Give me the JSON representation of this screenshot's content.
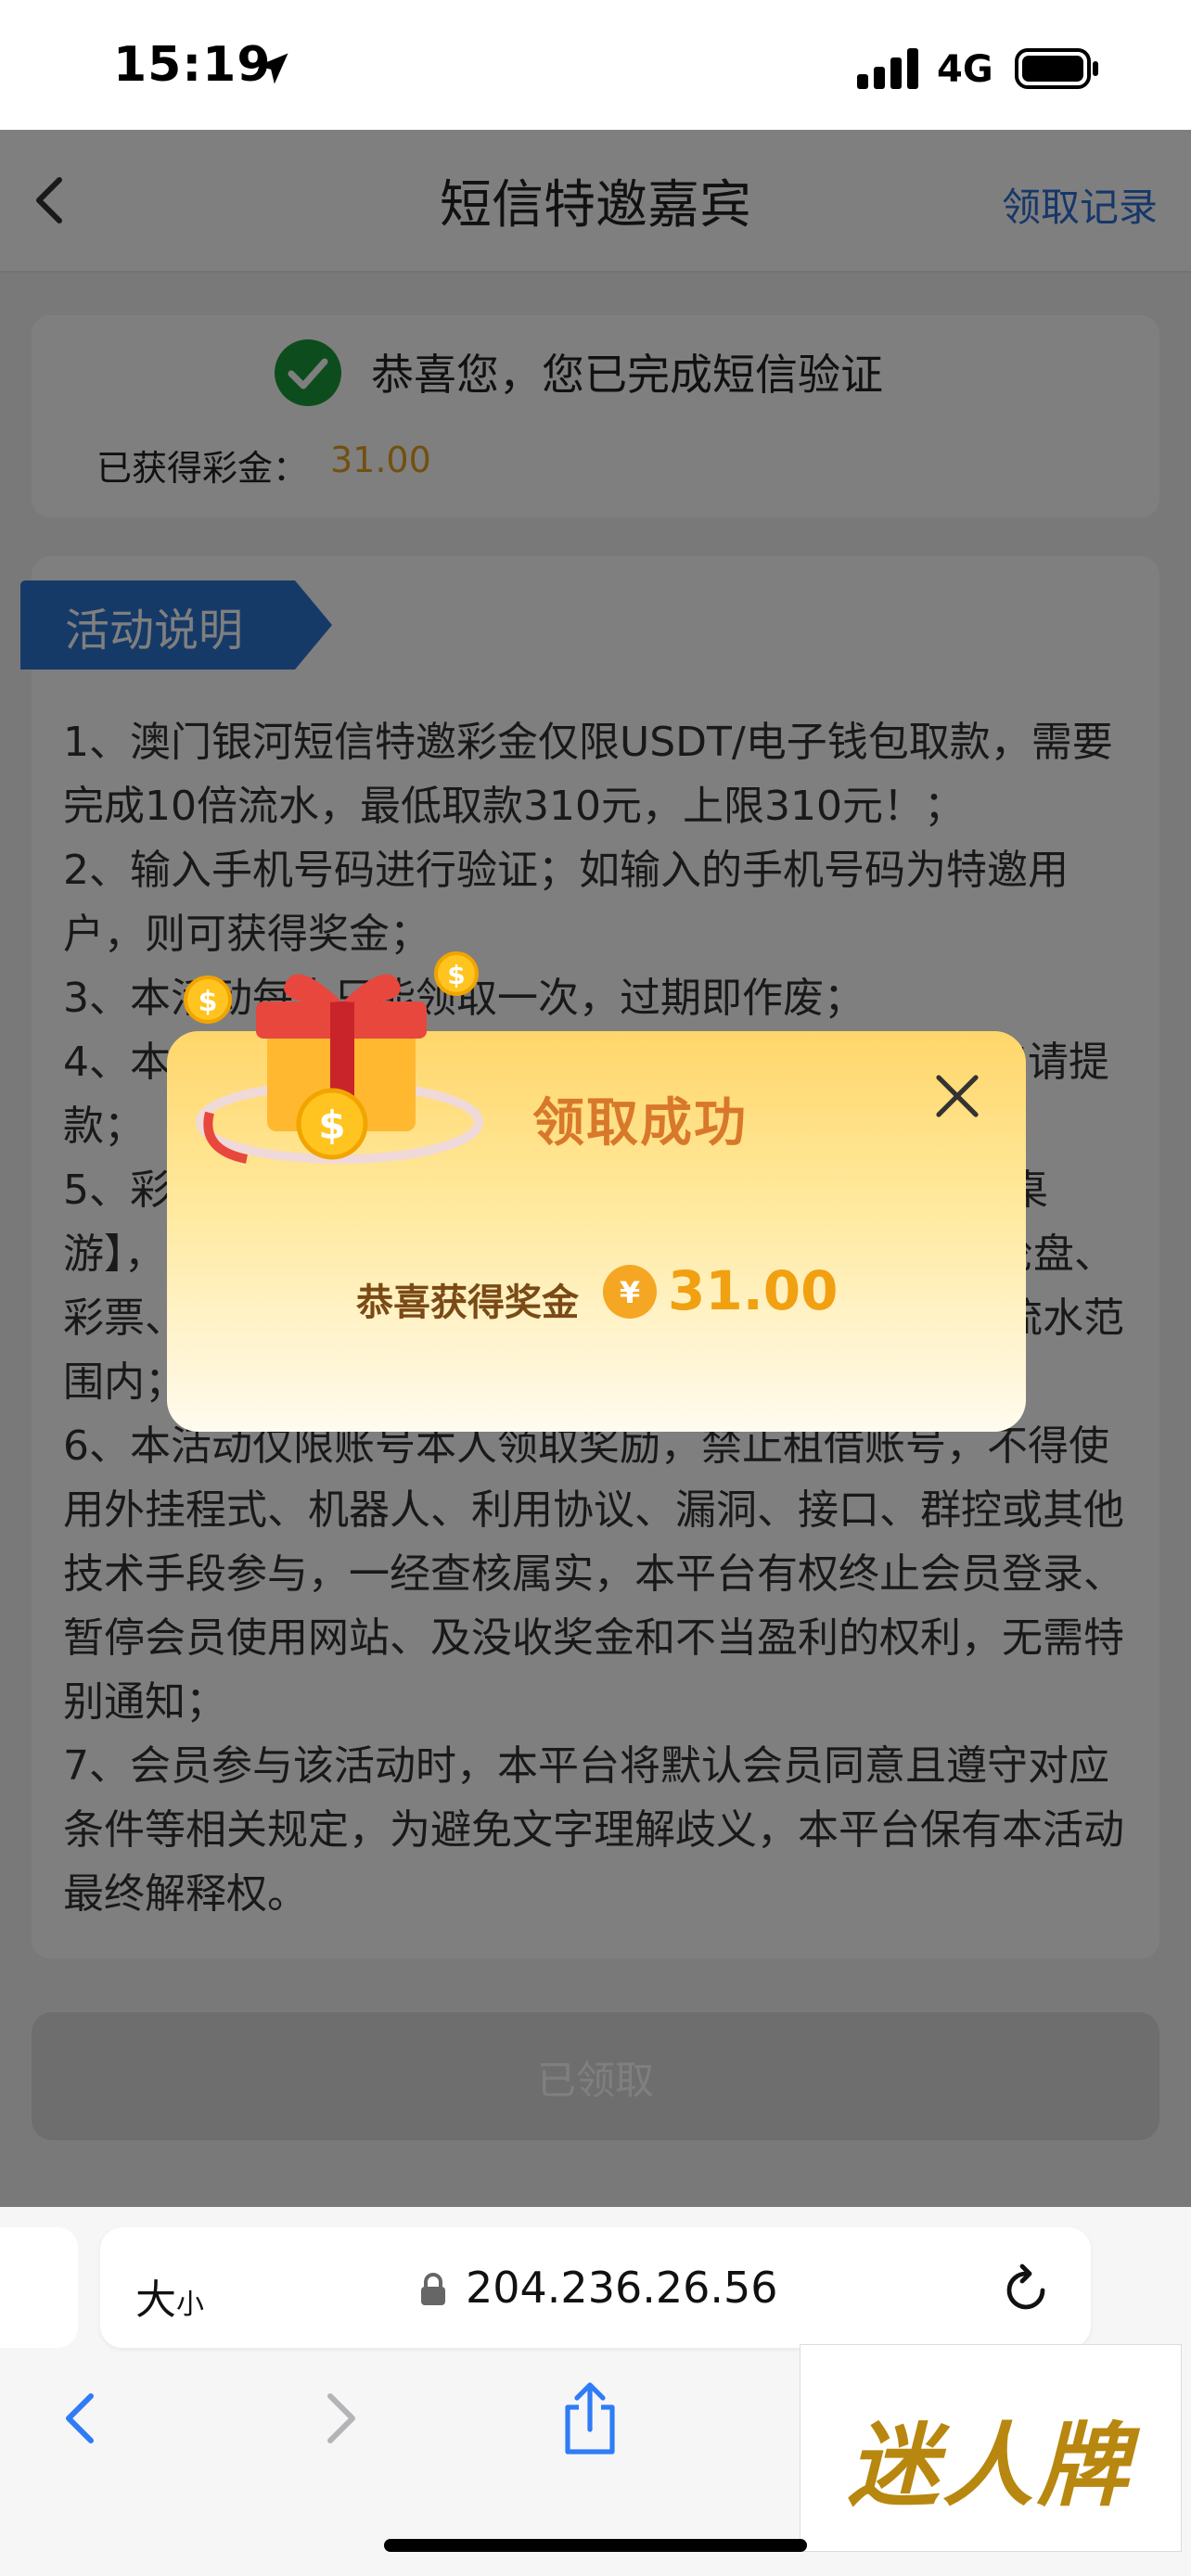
{
  "status_bar": {
    "time": "15:19",
    "network": "4G"
  },
  "header": {
    "title": "短信特邀嘉宾",
    "records_link": "领取记录"
  },
  "verify_card": {
    "message": "恭喜您，您已完成短信验证",
    "bonus_label": "已获得彩金：",
    "bonus_value": "31.00"
  },
  "activity": {
    "tag": "活动说明",
    "rules": [
      "1、澳门银河短信特邀彩金仅限USDT/电子钱包取款，需要完成10倍流水，最低取款310元，上限310元！；",
      "2、输入手机号码进行验证；如输入的手机号码为特邀用户，则可获得奖金；",
      "3、本活动每人只能领取一次，过期即作废；",
      "4、本活动彩金需要完成相应的流水，有效投注才能申请提款；",
      "5、彩金流水仅计算【棋牌】【电子】【捕鱼】【街机、桌游】，不计算【百家乐、龙虎、骰宝、21点、骰子、轮盘、彩票、体育、电竞】以及其他所有对冲投注不计算在流水范围内；",
      "6、本活动仅限账号本人领取奖励，禁止租借账号，不得使用外挂程式、机器人、利用协议、漏洞、接口、群控或其他技术手段参与，一经查核属实，本平台有权终止会员登录、暂停会员使用网站、及没收奖金和不当盈利的权利，无需特别通知；",
      "7、会员参与该活动时，本平台将默认会员同意且遵守对应条件等相关规定，为避免文字理解歧义，本平台保有本活动最终解释权。"
    ]
  },
  "claim_button": {
    "label": "已领取"
  },
  "popup": {
    "title": "领取成功",
    "prize_label": "恭喜获得奖金",
    "currency_symbol": "¥",
    "prize_value": "31.00"
  },
  "browser": {
    "font_size_label": "大",
    "font_size_small": "小",
    "url": "204.236.26.56"
  },
  "watermark": {
    "text": "迷人牌"
  },
  "colors": {
    "accent_blue": "#2f6fd3",
    "bonus_orange": "#e5a11e",
    "popup_title": "#d8782b",
    "prize_gold": "#f1a012",
    "check_green": "#1a9b3a"
  }
}
